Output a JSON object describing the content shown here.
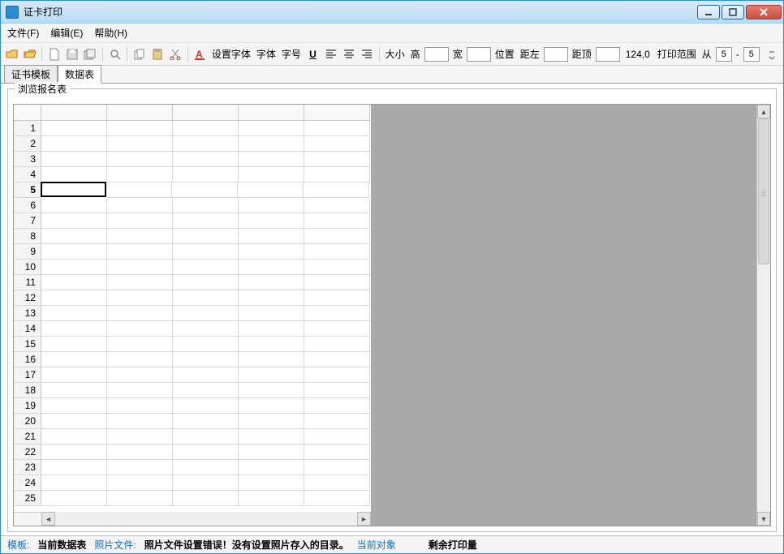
{
  "window": {
    "title": "证卡打印"
  },
  "menu": {
    "file": "文件(F)",
    "edit": "编辑(E)",
    "help": "帮助(H)"
  },
  "toolbar": {
    "set_font": "设置字体",
    "font": "字体",
    "font_size": "字号",
    "size": "大小",
    "height": "高",
    "width": "宽",
    "position": "位置",
    "left": "距左",
    "top": "距顶",
    "coord": "124,0",
    "print_range": "打印范围",
    "from": "从",
    "from_val": "5",
    "dash": "-",
    "to_val": "5"
  },
  "tabs": {
    "template": "证书模板",
    "data": "数据表"
  },
  "panel": {
    "title": "浏览报名表",
    "footer_hint": ""
  },
  "grid": {
    "rows": [
      1,
      2,
      3,
      4,
      5,
      6,
      7,
      8,
      9,
      10,
      11,
      12,
      13,
      14,
      15,
      16,
      17,
      18,
      19,
      20,
      21,
      22,
      23,
      24,
      25
    ],
    "selected_row": 5,
    "selected_col": 1
  },
  "status": {
    "template_label": "模板:",
    "template_val": "当前数据表",
    "photo_label": "照片文件:",
    "photo_val": "照片文件设置错误！没有设置照片存入的目录。",
    "obj_label": "当前对象",
    "remain_label": "剩余打印量"
  }
}
